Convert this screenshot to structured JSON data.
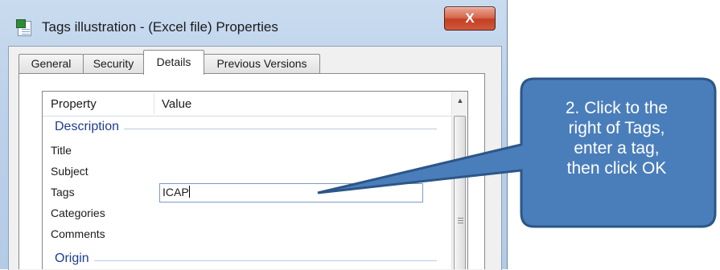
{
  "window": {
    "title": "Tags illustration - (Excel file) Properties",
    "close_label": "X"
  },
  "tabs": [
    {
      "label": "General",
      "active": false
    },
    {
      "label": "Security",
      "active": false
    },
    {
      "label": "Details",
      "active": true
    },
    {
      "label": "Previous Versions",
      "active": false
    }
  ],
  "list": {
    "columns": [
      "Property",
      "Value"
    ],
    "groups": [
      {
        "label": "Description",
        "rows": [
          {
            "property": "Title",
            "value": ""
          },
          {
            "property": "Subject",
            "value": ""
          },
          {
            "property": "Tags",
            "value": "ICAP",
            "editing": true
          },
          {
            "property": "Categories",
            "value": ""
          },
          {
            "property": "Comments",
            "value": ""
          }
        ]
      },
      {
        "label": "Origin",
        "rows": []
      }
    ]
  },
  "callout": {
    "text": "2. Click to the\nright of Tags,\nenter a tag,\nthen click OK",
    "fill": "#4a7ebb",
    "stroke": "#2c5687"
  },
  "colors": {
    "titlebar": "#c3d6ec",
    "group_label": "#1e3d8f",
    "close_button": "#c9472a"
  }
}
